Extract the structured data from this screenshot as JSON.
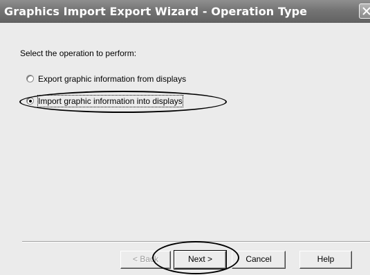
{
  "window": {
    "title": "Graphics Import Export Wizard - Operation Type"
  },
  "prompt": "Select the operation to perform:",
  "options": [
    {
      "label": "Export graphic information from displays",
      "selected": false
    },
    {
      "label": "Import graphic information into displays",
      "selected": true
    }
  ],
  "buttons": {
    "back": "< Back",
    "next": "Next >",
    "cancel": "Cancel",
    "help": "Help"
  },
  "icons": {
    "close": "close-icon"
  }
}
